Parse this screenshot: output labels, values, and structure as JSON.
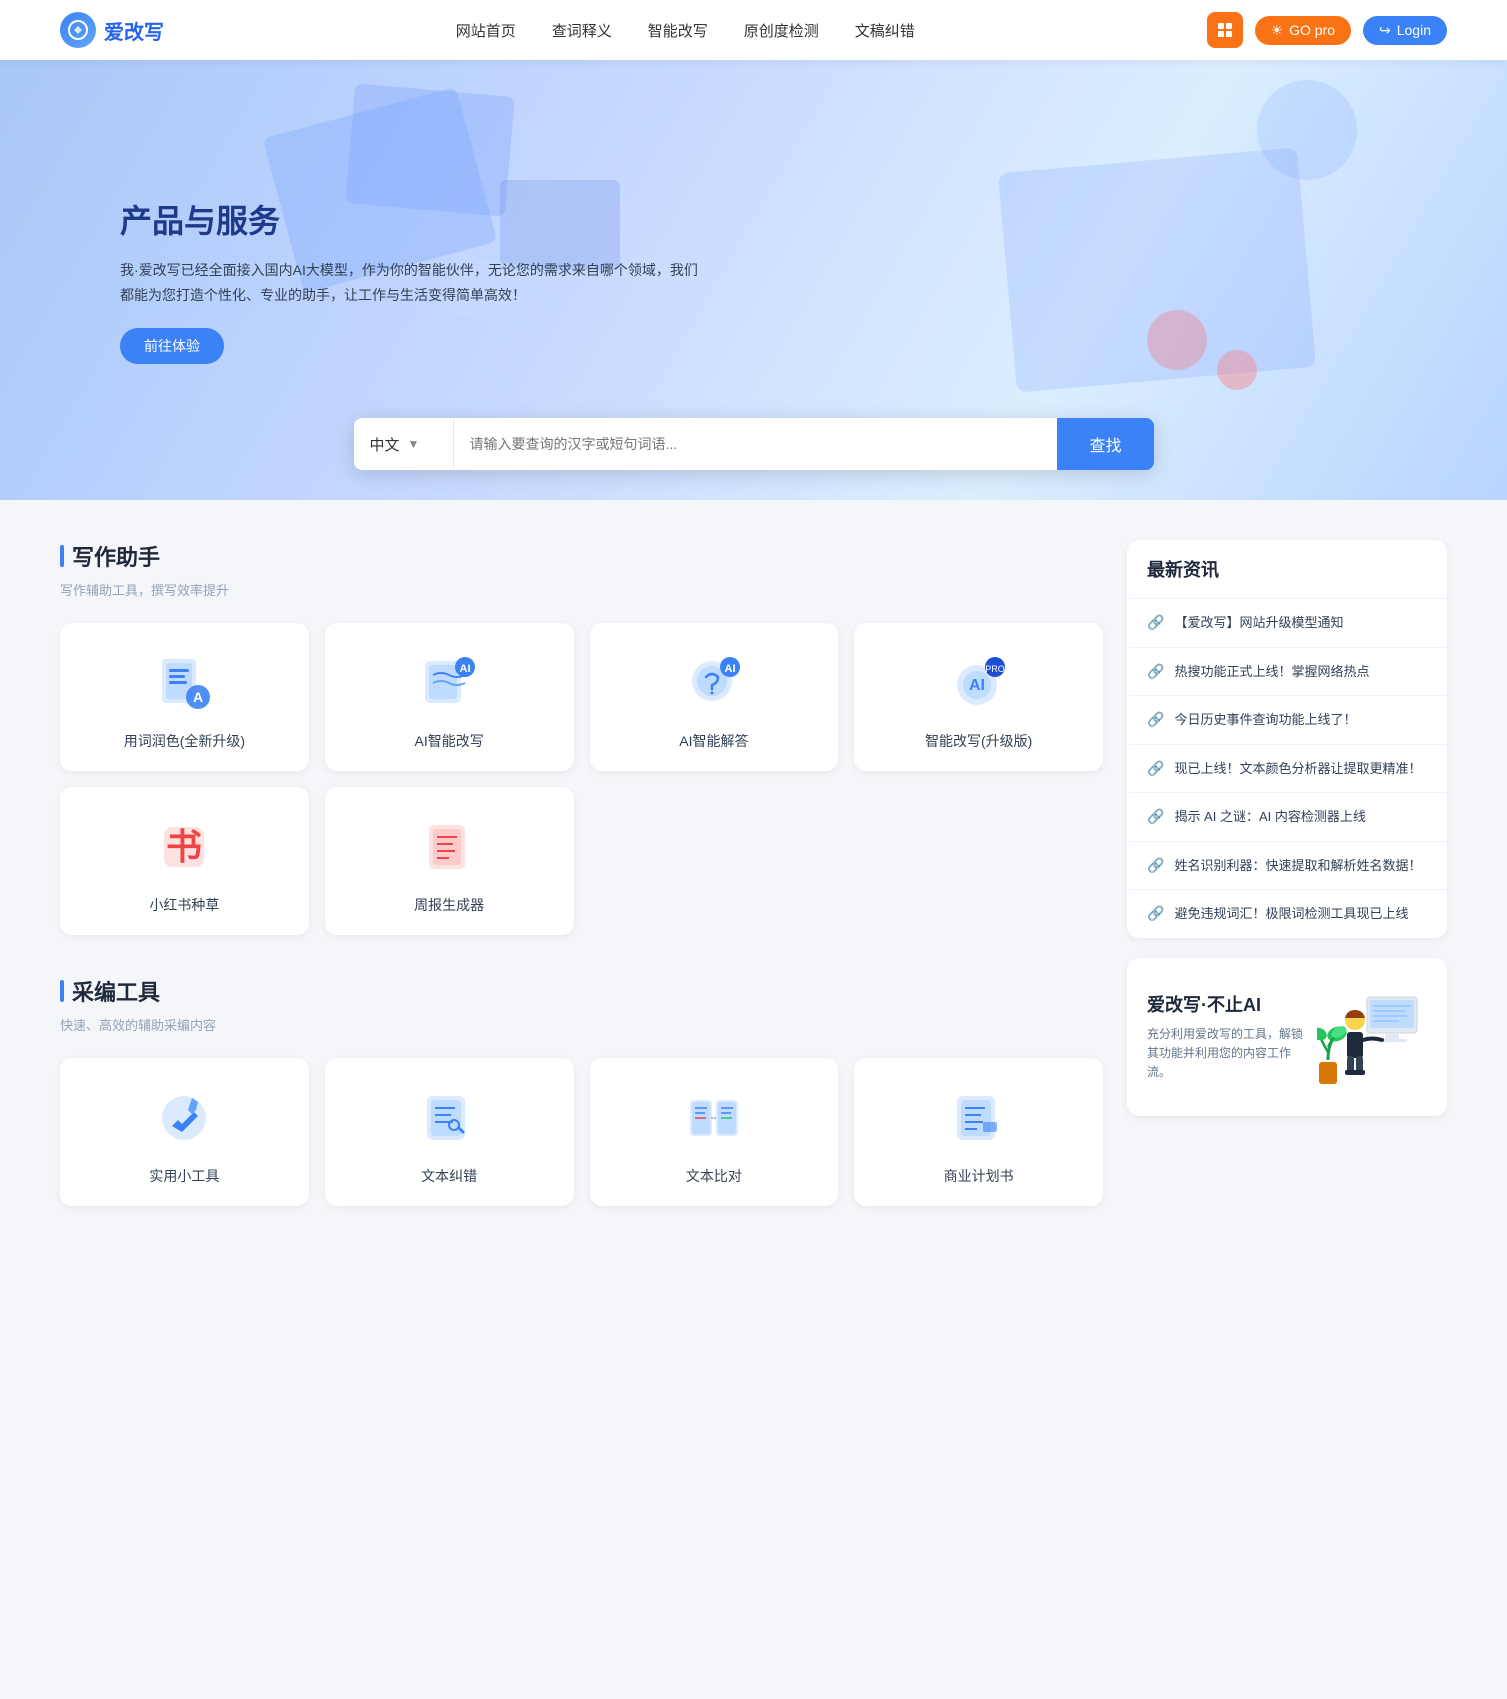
{
  "nav": {
    "logo_text": "爱改写",
    "links": [
      "网站首页",
      "查词释义",
      "智能改写",
      "原创度检测",
      "文稿纠错"
    ],
    "btn_grid_label": "grid",
    "btn_go_pro": "GO pro",
    "btn_login": "Login"
  },
  "hero": {
    "title": "产品与服务",
    "description": "我·爱改写已经全面接入国内AI大模型，作为你的智能伙伴，无论您的需求来自哪个领域，我们都能为您打造个性化、专业的助手，让工作与生活变得简单高效！",
    "btn_experience": "前往体验"
  },
  "search": {
    "lang": "中文",
    "placeholder": "请输入要查询的汉字或短句词语...",
    "btn_label": "查找"
  },
  "writing_tools": {
    "section_title": "写作助手",
    "section_subtitle": "写作辅助工具，撰写效率提升",
    "tools": [
      {
        "id": "word-coloring",
        "label": "用词润色(全新升级)",
        "icon_type": "doc-blue"
      },
      {
        "id": "ai-rewrite",
        "label": "AI智能改写",
        "icon_type": "ai-rewrite"
      },
      {
        "id": "ai-answer",
        "label": "AI智能解答",
        "icon_type": "ai-answer"
      },
      {
        "id": "smart-rewrite-pro",
        "label": "智能改写(升级版)",
        "icon_type": "smart-pro"
      },
      {
        "id": "xiaohongshu",
        "label": "小红书种草",
        "icon_type": "book-red"
      },
      {
        "id": "weekly-report",
        "label": "周报生成器",
        "icon_type": "report-red"
      }
    ]
  },
  "sampling_tools": {
    "section_title": "采编工具",
    "section_subtitle": "快速、高效的辅助采编内容",
    "tools": [
      {
        "id": "utility-tools",
        "label": "实用小工具",
        "icon_type": "wrench-blue"
      },
      {
        "id": "text-correction",
        "label": "文本纠错",
        "icon_type": "correction-blue"
      },
      {
        "id": "text-compare",
        "label": "文本比对",
        "icon_type": "compare-blue"
      },
      {
        "id": "business-plan",
        "label": "商业计划书",
        "icon_type": "plan-blue"
      }
    ]
  },
  "news": {
    "section_title": "最新资讯",
    "items": [
      "【爱改写】网站升级模型通知",
      "热搜功能正式上线！掌握网络热点",
      "今日历史事件查询功能上线了！",
      "现已上线！文本颜色分析器让提取更精准！",
      "揭示 AI 之谜：AI 内容检测器上线",
      "姓名识别利器：快速提取和解析姓名数据！",
      "避免违规词汇！极限词检测工具现已上线"
    ]
  },
  "promo": {
    "title": "爱改写·不止AI",
    "description": "充分利用爱改写的工具，解锁其功能并利用您的内容工作流。"
  }
}
